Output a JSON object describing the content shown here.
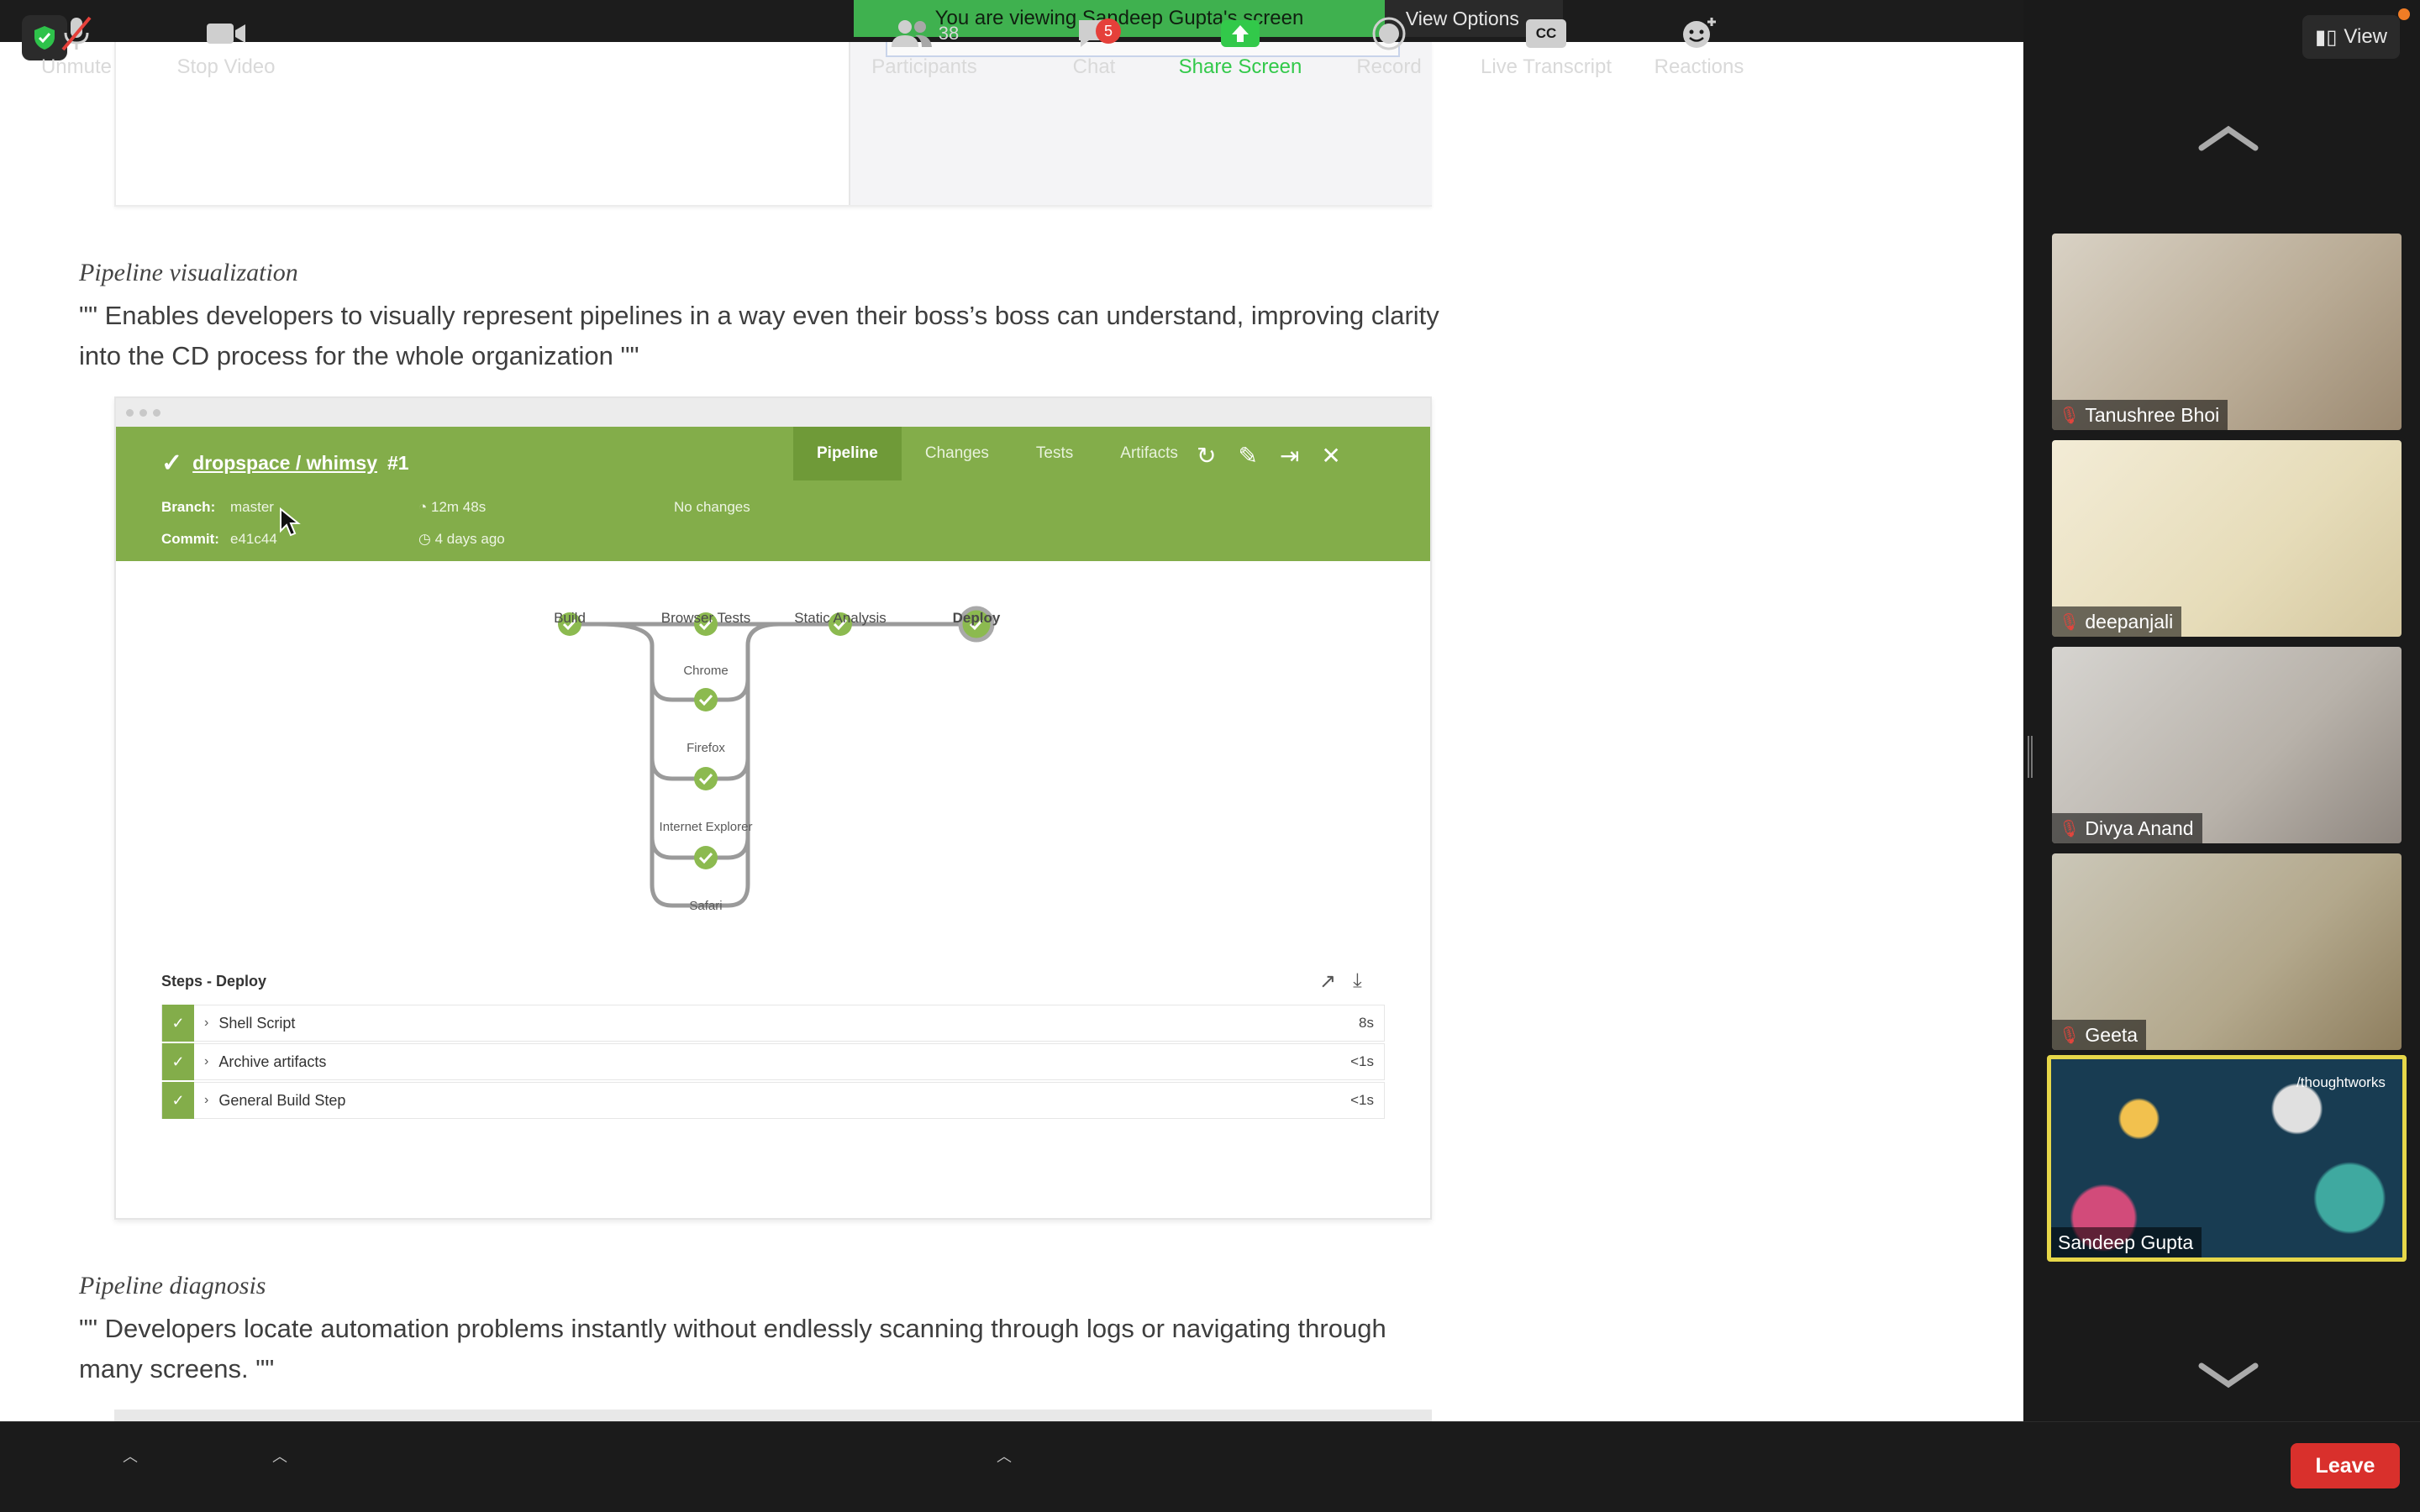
{
  "screen_share": {
    "banner_text": "You are viewing Sandeep Gupta's screen",
    "view_options_label": "View Options"
  },
  "document": {
    "section1": {
      "title": "Pipeline visualization",
      "body": "\"\" Enables developers to visually represent pipelines in a way even their boss’s boss can understand, improving clarity into the CD process for the whole organization \"\""
    },
    "section2": {
      "title": "Pipeline diagnosis",
      "body": "\"\" Developers locate automation problems instantly without endlessly scanning through logs or navigating through many screens. \"\""
    }
  },
  "jenkins": {
    "title_link": "dropspace / whimsy",
    "run_number": "#1",
    "tabs": [
      "Pipeline",
      "Changes",
      "Tests",
      "Artifacts"
    ],
    "active_tab": "Pipeline",
    "branch_label": "Branch:",
    "branch_value": "master",
    "commit_label": "Commit:",
    "commit_value": "e41c44",
    "duration": "12m 48s",
    "time_ago": "4 days ago",
    "changes": "No changes",
    "stages": [
      "Build",
      "Browser Tests",
      "Static Analysis",
      "Deploy"
    ],
    "parallel_nodes": [
      "Chrome",
      "Firefox",
      "Internet Explorer",
      "Safari"
    ],
    "steps_title": "Steps - Deploy",
    "steps": [
      {
        "name": "Shell Script",
        "duration": "8s"
      },
      {
        "name": "Archive artifacts",
        "duration": "<1s"
      },
      {
        "name": "General Build Step",
        "duration": "<1s"
      }
    ]
  },
  "gallery": {
    "view_label": "View",
    "participants": [
      {
        "name": "Tanushree Bhoi",
        "muted": true
      },
      {
        "name": "deepanjali",
        "muted": true
      },
      {
        "name": "Divya Anand",
        "muted": true
      },
      {
        "name": "Geeta",
        "muted": true
      },
      {
        "name": "Sandeep Gupta",
        "muted": false,
        "active": true
      }
    ],
    "active_speaker_brand": "/thoughtworks"
  },
  "toolbar": {
    "unmute": "Unmute",
    "stop_video": "Stop Video",
    "participants": "Participants",
    "participants_count": "38",
    "chat": "Chat",
    "chat_badge": "5",
    "share_screen": "Share Screen",
    "record": "Record",
    "live_transcript": "Live Transcript",
    "cc": "CC",
    "reactions": "Reactions",
    "leave": "Leave"
  },
  "colors": {
    "jenkins_green": "#83ad4a",
    "banner_green": "#3fb14f",
    "leave_red": "#d9302c",
    "active_border": "#e6d749"
  }
}
